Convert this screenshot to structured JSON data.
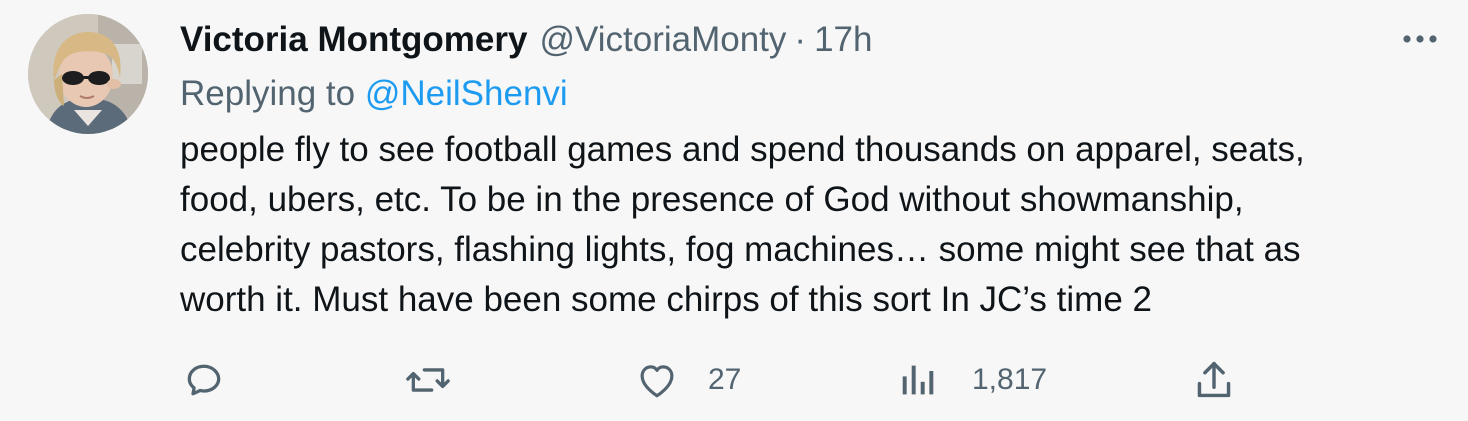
{
  "tweet": {
    "author": {
      "display_name": "Victoria Montgomery",
      "handle": "@VictoriaMonty",
      "separator": "·",
      "time": "17h"
    },
    "replying": {
      "prefix": "Replying to",
      "handle": "@NeilShenvi"
    },
    "body_lines": [
      "people fly to see football games and spend thousands on apparel, seats,",
      "food, ubers, etc. To be in the presence of God without showmanship,",
      "celebrity pastors, flashing lights, fog machines… some might see that as",
      "worth it. Must have been some chirps of this sort In JC’s time 2"
    ],
    "actions": {
      "reply": {
        "icon": "reply-icon"
      },
      "retweet": {
        "icon": "retweet-icon"
      },
      "like": {
        "icon": "heart-icon",
        "count": "27"
      },
      "views": {
        "icon": "views-icon",
        "count": "1,817"
      },
      "share": {
        "icon": "share-icon"
      }
    },
    "more_icon": "more-icon",
    "colors": {
      "background": "#f7f7f7",
      "text": "#0f1419",
      "secondary": "#536471",
      "link": "#1d9bf0"
    }
  }
}
